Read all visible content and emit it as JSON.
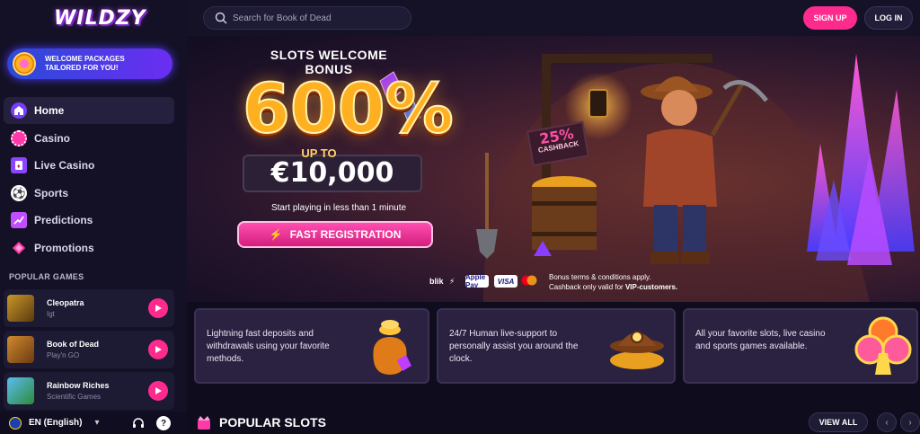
{
  "brand": {
    "logo": "WILDZY",
    "accent": "#ff2a8e"
  },
  "sidebar": {
    "welcome": {
      "line1": "WELCOME PACKAGES",
      "line2": "TAILORED FOR YOU!"
    },
    "items": [
      {
        "label": "Home",
        "icon": "home-icon",
        "active": true
      },
      {
        "label": "Casino",
        "icon": "casino-chip-icon"
      },
      {
        "label": "Live Casino",
        "icon": "cards-icon"
      },
      {
        "label": "Sports",
        "icon": "soccer-ball-icon"
      },
      {
        "label": "Predictions",
        "icon": "predictions-icon"
      },
      {
        "label": "Promotions",
        "icon": "diamond-icon"
      }
    ],
    "popular_title": "POPULAR GAMES",
    "games": [
      {
        "name": "Cleopatra",
        "provider": "Igt"
      },
      {
        "name": "Book of Dead",
        "provider": "Play'n GO"
      },
      {
        "name": "Rainbow Riches",
        "provider": "Scientific Games"
      }
    ],
    "language": "EN (English)"
  },
  "topbar": {
    "search_placeholder": "Search for Book of Dead",
    "signup": "SIGN UP",
    "login": "LOG IN"
  },
  "hero": {
    "title": "SLOTS WELCOME BONUS",
    "percent": "600%",
    "upto": "UP TO",
    "amount": "€10,000",
    "subtext": "Start playing in less than 1 minute",
    "cta": "FAST REGISTRATION",
    "cashback_pct": "25%",
    "cashback_label": "CASHBACK",
    "payments": [
      "blik",
      "Apple Pay",
      "VISA"
    ],
    "terms_line1": "Bonus terms & conditions apply.",
    "terms_line2_prefix": "Cashback only valid for ",
    "terms_line2_bold": "VIP-customers."
  },
  "features": [
    {
      "text": "Lightning fast deposits and withdrawals using your favorite methods."
    },
    {
      "text": "24/7 Human live-support to personally assist you around the clock."
    },
    {
      "text": "All your favorite slots, live casino and sports games available."
    }
  ],
  "popular_slots": {
    "title": "POPULAR SLOTS",
    "view_all": "VIEW ALL"
  }
}
